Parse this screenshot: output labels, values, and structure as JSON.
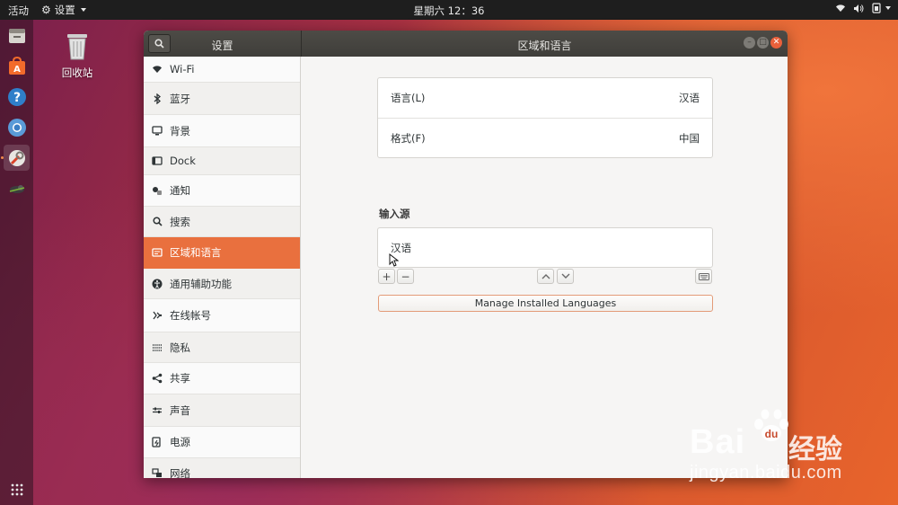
{
  "topbar": {
    "activities": "活动",
    "app_menu": "设置",
    "clock": "星期六 12：36",
    "tray": [
      "network-icon",
      "volume-icon",
      "power-icon"
    ]
  },
  "dock": {
    "items": [
      "files-icon",
      "software-icon",
      "help-icon",
      "chromium-icon",
      "settings-icon",
      "app-icon"
    ],
    "show_apps_icon": "grid-icon"
  },
  "desktop": {
    "trash_label": "回收站"
  },
  "window": {
    "sidebar_title": "设置",
    "main_title": "区域和语言",
    "controls": [
      "minimize",
      "maximize",
      "close"
    ]
  },
  "sidebar": {
    "items": [
      {
        "label": "Wi-Fi",
        "icon": "wifi-icon"
      },
      {
        "label": "蓝牙",
        "icon": "bluetooth-icon"
      },
      {
        "label": "背景",
        "icon": "background-icon"
      },
      {
        "label": "Dock",
        "icon": "dock-icon"
      },
      {
        "label": "通知",
        "icon": "notification-icon"
      },
      {
        "label": "搜索",
        "icon": "search-icon"
      },
      {
        "label": "区域和语言",
        "icon": "region-icon",
        "selected": true
      },
      {
        "label": "通用辅助功能",
        "icon": "accessibility-icon"
      },
      {
        "label": "在线帐号",
        "icon": "online-accounts-icon"
      },
      {
        "label": "隐私",
        "icon": "privacy-icon"
      },
      {
        "label": "共享",
        "icon": "share-icon"
      },
      {
        "label": "声音",
        "icon": "sound-icon"
      },
      {
        "label": "电源",
        "icon": "power-icon"
      },
      {
        "label": "网络",
        "icon": "network-icon"
      }
    ]
  },
  "main": {
    "language": {
      "label": "语言(L)",
      "value": "汉语"
    },
    "formats": {
      "label": "格式(F)",
      "value": "中国"
    },
    "input_sources_title": "输入源",
    "input_sources": [
      "汉语"
    ],
    "add_label": "+",
    "remove_label": "−",
    "manage_button": "Manage Installed Languages"
  },
  "watermark": {
    "brand": "Bai",
    "brand2": "u",
    "chinese": "经验",
    "url": "jingyan.baidu.com"
  },
  "colors": {
    "accent": "#e9703e",
    "titlebar": "#3f3e3a",
    "close": "#e9603b"
  }
}
